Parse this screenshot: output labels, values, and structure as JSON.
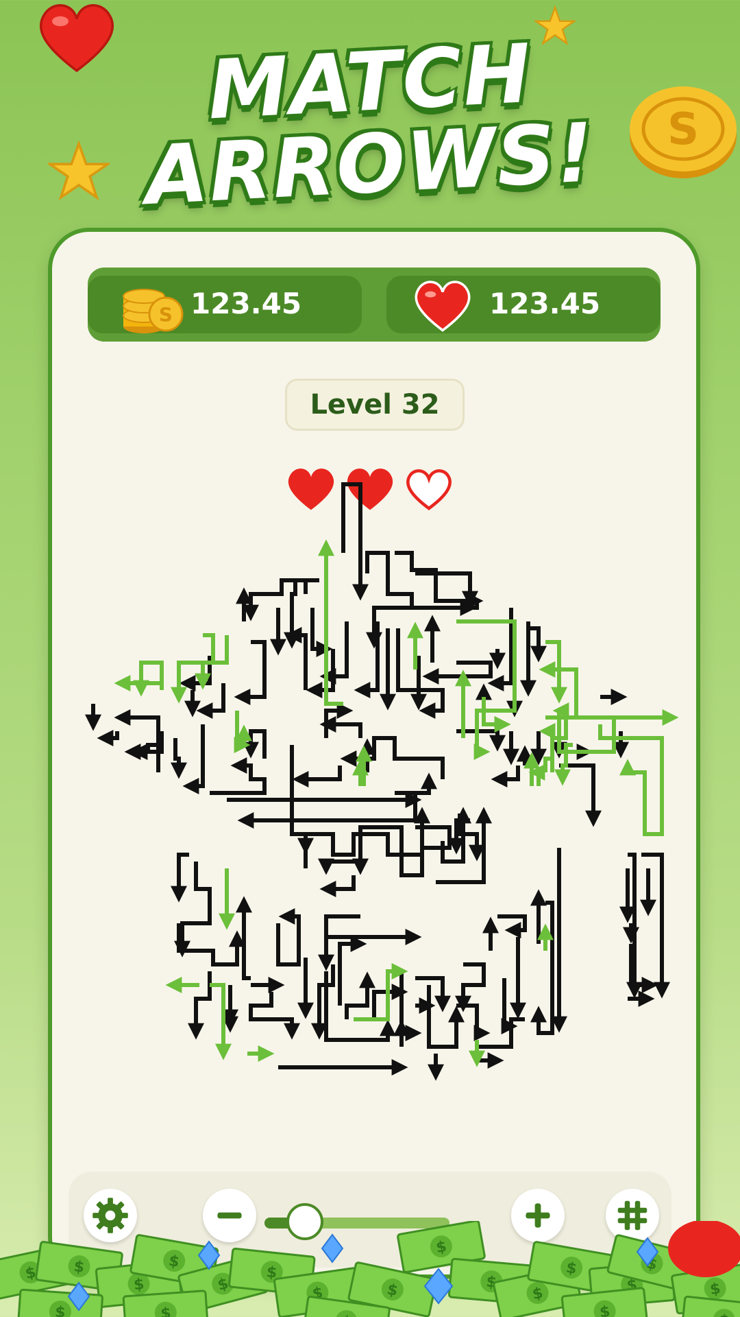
{
  "title": {
    "line1": "MATCH",
    "line2": "ARROWS!"
  },
  "header": {
    "coins": {
      "icon": "coin-stack-icon",
      "value": "123.45"
    },
    "lives": {
      "icon": "heart-icon",
      "value": "123.45"
    }
  },
  "level": {
    "label": "Level 32"
  },
  "attempts": {
    "total": 3,
    "remaining": 2
  },
  "toolbar": {
    "settings_icon": "gear-icon",
    "zoom_out_icon": "minus-icon",
    "zoom_in_icon": "plus-icon",
    "grid_icon": "hash-grid-icon",
    "zoom_level": 0.22
  },
  "colors": {
    "accent": "#4c8a27",
    "arrow_dark": "#111111",
    "arrow_green": "#6cbf3a",
    "heart": "#e8261f",
    "coin": "#f2b40d"
  }
}
